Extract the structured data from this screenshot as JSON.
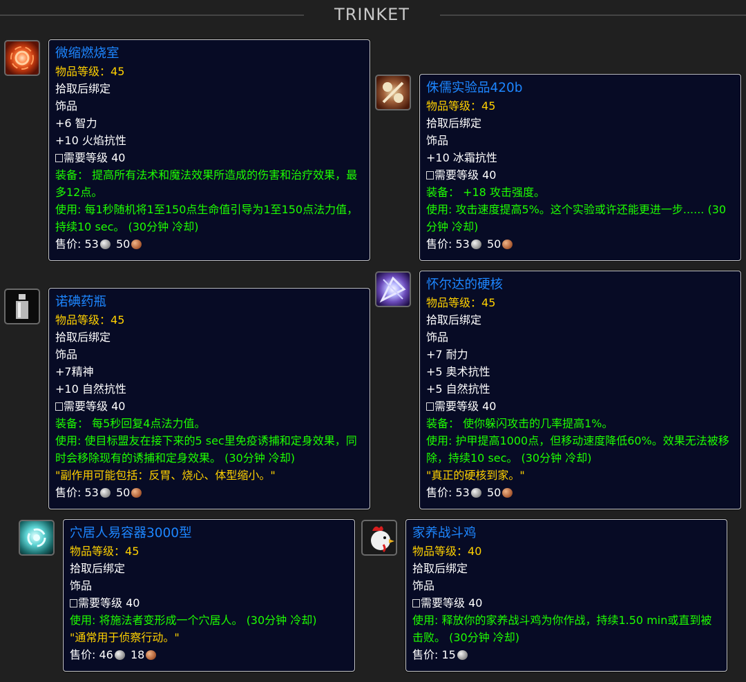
{
  "header": {
    "title": "TRINKET"
  },
  "labels": {
    "ilvl": "物品等级：",
    "bind": "拾取后绑定",
    "slot": "饰品",
    "req": "需要等级 40",
    "sell": "售价: "
  },
  "items": [
    {
      "name": "微缩燃烧室",
      "ilvl": "45",
      "stats": [
        "+6 智力",
        "+10 火焰抗性"
      ],
      "equip": "装备： 提高所有法术和魔法效果所造成的伤害和治疗效果，最多12点。",
      "use": "使用: 每1秒随机将1至150点生命值引导为1至150点法力值，持续10 sec。 (30分钟 冷却)",
      "silver": "53",
      "copper": "50",
      "icon": "fire-vortex-icon"
    },
    {
      "name": "侏儒实验品420b",
      "ilvl": "45",
      "stats": [
        "+10 冰霜抗性"
      ],
      "equip": "装备： +18 攻击强度。",
      "use": "使用: 攻击速度提高5%。这个实验或许还能更进一步...... (30分钟 冷却)",
      "silver": "53",
      "copper": "50",
      "icon": "gnomish-device-icon"
    },
    {
      "name": "诺碘药瓶",
      "ilvl": "45",
      "stats": [
        "+7精神",
        "+10 自然抗性"
      ],
      "equip": "装备： 每5秒回复4点法力值。",
      "use": "使用: 使目标盟友在接下来的5 sec里免疫诱捕和定身效果，同时会移除现有的诱捕和定身效果。 (30分钟 冷却)",
      "flavor": "\"副作用可能包括：反胃、烧心、体型缩小。\"",
      "silver": "53",
      "copper": "50",
      "icon": "vial-icon"
    },
    {
      "name": "怀尔达的硬核",
      "ilvl": "45",
      "stats": [
        "+7 耐力",
        "+5 奥术抗性",
        "+5 自然抗性"
      ],
      "equip": "装备： 使你躲闪攻击的几率提高1%。",
      "use": "使用: 护甲提高1000点，但移动速度降低60%。效果无法被移除，持续10 sec。 (30分钟 冷却)",
      "flavor": "\"真正的硬核到家。\"",
      "silver": "53",
      "copper": "50",
      "icon": "crystal-core-icon"
    },
    {
      "name": "穴居人易容器3000型",
      "ilvl": "45",
      "stats": [],
      "use": "使用: 将施法者变形成一个穴居人。 (30分钟 冷却)",
      "flavor": "\"通常用于侦察行动。\"",
      "silver": "46",
      "copper": "18",
      "icon": "frost-swirl-icon"
    },
    {
      "name": "家养战斗鸡",
      "ilvl": "40",
      "stats": [],
      "use": "使用: 释放你的家养战斗鸡为你作战，持续1.50 min或直到被击败。 (30分钟 冷却)",
      "silver": "15",
      "icon": "chicken-icon"
    }
  ]
}
